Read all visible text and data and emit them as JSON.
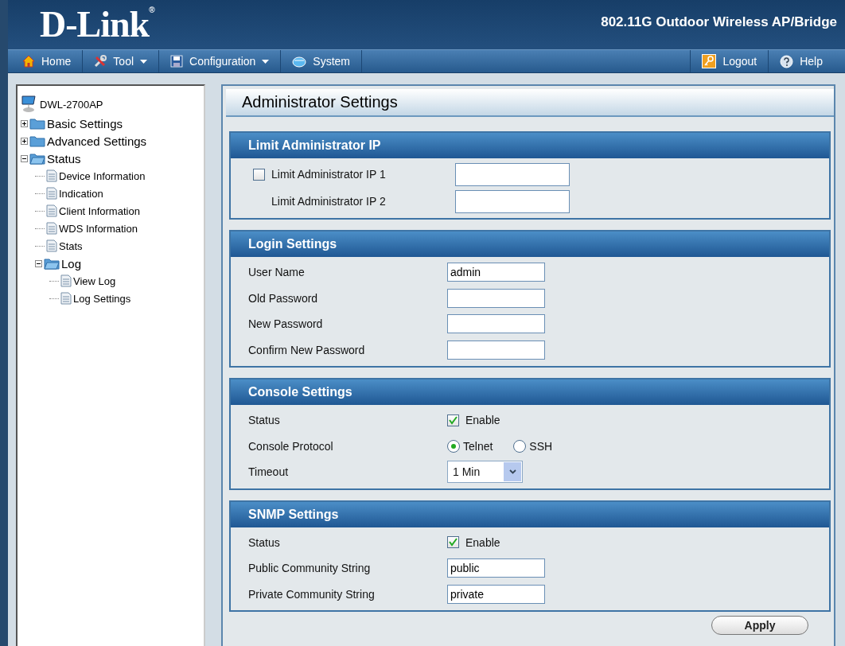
{
  "header": {
    "logo": "D-Link",
    "logo_mark": "®",
    "title": "802.11G Outdoor Wireless AP/Bridge"
  },
  "menu": {
    "left": [
      {
        "label": "Home",
        "dropdown": false
      },
      {
        "label": "Tool",
        "dropdown": true
      },
      {
        "label": "Configuration",
        "dropdown": true
      },
      {
        "label": "System",
        "dropdown": false
      }
    ],
    "right": [
      {
        "label": "Logout"
      },
      {
        "label": "Help"
      }
    ]
  },
  "tree": {
    "label": "DWL-2700AP",
    "children": [
      {
        "label": "Basic Settings",
        "kind": "folder",
        "expanded": false
      },
      {
        "label": "Advanced Settings",
        "kind": "folder",
        "expanded": false
      },
      {
        "label": "Status",
        "kind": "folder",
        "expanded": true,
        "children": [
          {
            "label": "Device Information",
            "kind": "page"
          },
          {
            "label": "Indication",
            "kind": "page"
          },
          {
            "label": "Client Information",
            "kind": "page"
          },
          {
            "label": "WDS Information",
            "kind": "page"
          },
          {
            "label": "Stats",
            "kind": "page"
          },
          {
            "label": "Log",
            "kind": "folder",
            "expanded": true,
            "children": [
              {
                "label": "View Log",
                "kind": "page"
              },
              {
                "label": "Log Settings",
                "kind": "page"
              }
            ]
          }
        ]
      }
    ]
  },
  "panel": {
    "title": "Administrator Settings",
    "sections": [
      {
        "title": "Limit Administrator IP",
        "rows": [
          {
            "kind": "checkbox-field",
            "label": "Limit Administrator IP 1",
            "checked": false
          },
          {
            "kind": "indented-field",
            "label": "Limit Administrator IP 2"
          }
        ]
      },
      {
        "title": "Login Settings",
        "rows": [
          {
            "kind": "field",
            "label": "User Name",
            "value": "admin"
          },
          {
            "kind": "field",
            "label": "Old Password"
          },
          {
            "kind": "field",
            "label": "New Password"
          },
          {
            "kind": "field",
            "label": "Confirm New Password"
          }
        ]
      },
      {
        "title": "Console Settings",
        "rows": [
          {
            "kind": "checkbox",
            "label": "Status",
            "option": "Enable",
            "checked": true
          },
          {
            "kind": "radio",
            "label": "Console Protocol",
            "options": [
              {
                "label": "Telnet",
                "selected": true
              },
              {
                "label": "SSH",
                "selected": false
              }
            ]
          },
          {
            "kind": "select",
            "label": "Timeout",
            "value": "1 Min"
          }
        ]
      },
      {
        "title": "SNMP Settings",
        "rows": [
          {
            "kind": "checkbox",
            "label": "Status",
            "option": "Enable",
            "checked": true
          },
          {
            "kind": "field",
            "label": "Public Community String",
            "value": "public"
          },
          {
            "kind": "field",
            "label": "Private Community String",
            "value": "private"
          }
        ]
      }
    ],
    "apply": "Apply"
  }
}
